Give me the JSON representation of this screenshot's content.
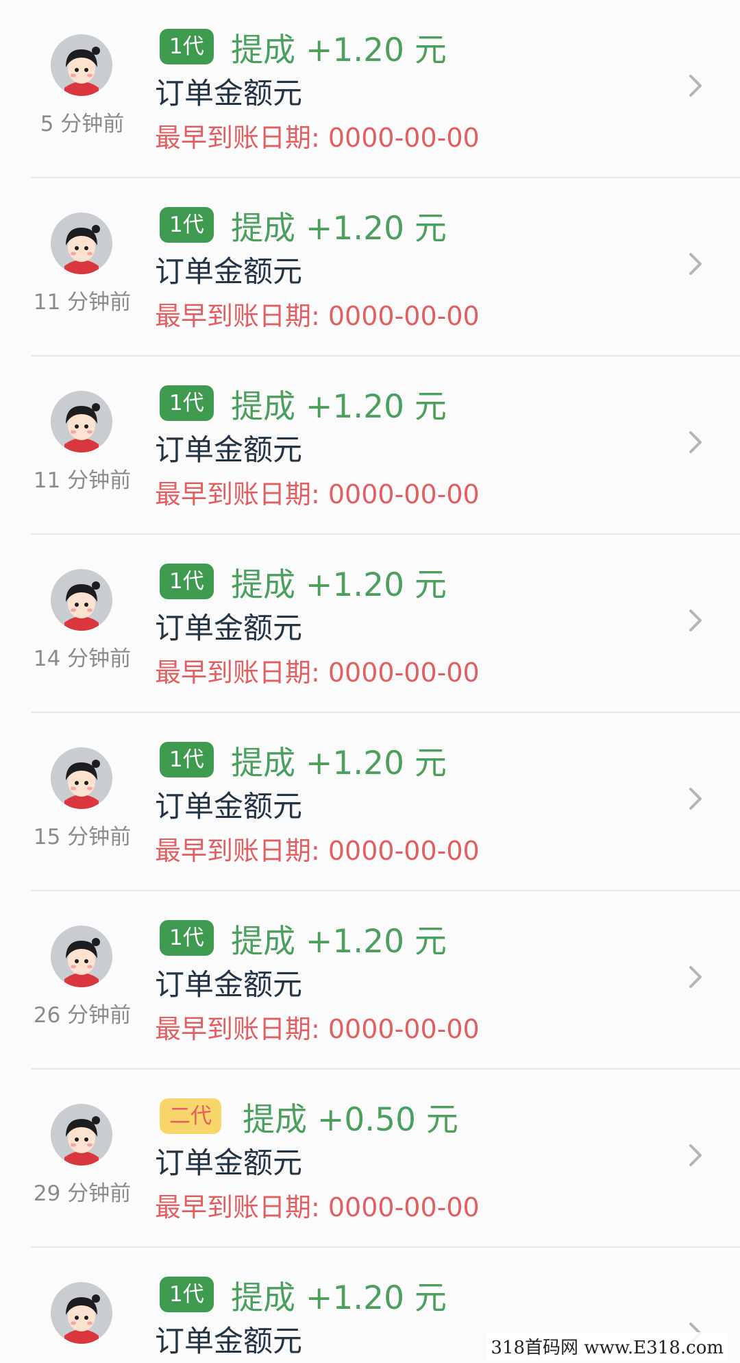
{
  "items": [
    {
      "time": "5 分钟前",
      "badge": "1代",
      "level": 1,
      "commission": "提成 +1.20 元",
      "order": "订单金额元",
      "date": "最早到账日期: 0000-00-00"
    },
    {
      "time": "11 分钟前",
      "badge": "1代",
      "level": 1,
      "commission": "提成 +1.20 元",
      "order": "订单金额元",
      "date": "最早到账日期: 0000-00-00"
    },
    {
      "time": "11 分钟前",
      "badge": "1代",
      "level": 1,
      "commission": "提成 +1.20 元",
      "order": "订单金额元",
      "date": "最早到账日期: 0000-00-00"
    },
    {
      "time": "14 分钟前",
      "badge": "1代",
      "level": 1,
      "commission": "提成 +1.20 元",
      "order": "订单金额元",
      "date": "最早到账日期: 0000-00-00"
    },
    {
      "time": "15 分钟前",
      "badge": "1代",
      "level": 1,
      "commission": "提成 +1.20 元",
      "order": "订单金额元",
      "date": "最早到账日期: 0000-00-00"
    },
    {
      "time": "26 分钟前",
      "badge": "1代",
      "level": 1,
      "commission": "提成 +1.20 元",
      "order": "订单金额元",
      "date": "最早到账日期: 0000-00-00"
    },
    {
      "time": "29 分钟前",
      "badge": "二代",
      "level": 2,
      "commission": "提成 +0.50 元",
      "order": "订单金额元",
      "date": "最早到账日期: 0000-00-00"
    },
    {
      "time": "",
      "badge": "1代",
      "level": 1,
      "commission": "提成 +1.20 元",
      "order": "订单金额元",
      "date": ""
    }
  ],
  "icons": {
    "avatar": "cartoon-girl-avatar-icon",
    "chevron": "chevron-right-icon"
  },
  "colors": {
    "badge_lvl1": "#3d9a4f",
    "badge_lvl2": "#f8d66b",
    "commission": "#4aa05c",
    "date": "#e25f61",
    "order": "#233445"
  },
  "watermark": "318首码网 www.E318.com"
}
